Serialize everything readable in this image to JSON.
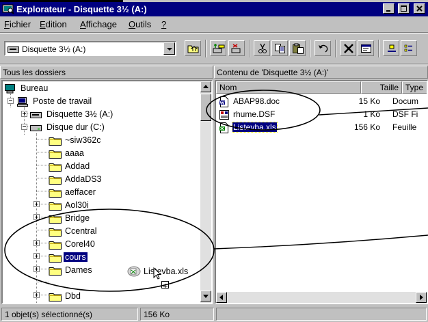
{
  "window": {
    "title": "Explorateur - Disquette 3½ (A:)",
    "title_icon": "explorer-icon",
    "controls": [
      "minimize-icon",
      "maximize-icon",
      "close-icon"
    ]
  },
  "menu": [
    {
      "label": "Fichier",
      "mnemonic": "F",
      "rest": "ichier"
    },
    {
      "label": "Edition",
      "mnemonic": "E",
      "rest": "dition"
    },
    {
      "label": "Affichage",
      "mnemonic": "A",
      "rest": "ffichage"
    },
    {
      "label": "Outils",
      "mnemonic": "O",
      "rest": "utils"
    },
    {
      "label": "?",
      "mnemonic": "?",
      "rest": ""
    }
  ],
  "toolbar": {
    "address_value": "Disquette 3½ (A:)",
    "buttons": [
      "up-folder-icon",
      "map-drive-icon",
      "disconnect-drive-icon",
      "cut-icon",
      "copy-icon",
      "paste-icon",
      "undo-icon",
      "delete-icon",
      "properties-icon",
      "large-icons-icon",
      "small-icons-icon"
    ]
  },
  "left_pane": {
    "header": "Tous les dossiers",
    "tree": [
      {
        "label": "Bureau",
        "icon": "desktop-icon",
        "level": 0,
        "expander": ""
      },
      {
        "label": "Poste de travail",
        "icon": "computer-icon",
        "level": 1,
        "expander": "minus"
      },
      {
        "label": "Disquette 3½ (A:)",
        "icon": "floppy-drive-icon",
        "level": 2,
        "expander": "plus"
      },
      {
        "label": "Disque dur (C:)",
        "icon": "hard-drive-icon",
        "level": 2,
        "expander": "minus"
      },
      {
        "label": "~siw362c",
        "icon": "folder-icon",
        "level": 3,
        "expander": ""
      },
      {
        "label": "aaaa",
        "icon": "folder-icon",
        "level": 3,
        "expander": ""
      },
      {
        "label": "Addad",
        "icon": "folder-icon",
        "level": 3,
        "expander": ""
      },
      {
        "label": "AddaDS3",
        "icon": "folder-icon",
        "level": 3,
        "expander": ""
      },
      {
        "label": "aeffacer",
        "icon": "folder-icon",
        "level": 3,
        "expander": "plus"
      },
      {
        "label": "Aol30i",
        "icon": "folder-icon",
        "level": 3,
        "expander": "plus"
      },
      {
        "label": "Bridge",
        "icon": "folder-icon",
        "level": 3,
        "expander": ""
      },
      {
        "label": "Ccentral",
        "icon": "folder-icon",
        "level": 3,
        "expander": "plus"
      },
      {
        "label": "Corel40",
        "icon": "folder-icon",
        "level": 3,
        "expander": "plus"
      },
      {
        "label": "cours",
        "icon": "folder-icon",
        "level": 3,
        "expander": "plus",
        "selected": true
      },
      {
        "label": "Dames",
        "icon": "folder-icon",
        "level": 3,
        "expander": ""
      },
      {
        "label": "Dbd",
        "icon": "folder-icon",
        "level": 3,
        "expander": "plus"
      }
    ],
    "drag_ghost": {
      "label": "Listevba.xls",
      "icon": "excel-file-icon"
    }
  },
  "right_pane": {
    "header": "Contenu de 'Disquette 3½ (A:)'",
    "columns": [
      "Nom",
      "Taille",
      "Type"
    ],
    "files": [
      {
        "name": "ABAP98.doc",
        "size": "15 Ko",
        "type": "Docum",
        "icon": "word-doc-icon"
      },
      {
        "name": "rhume.DSF",
        "size": "1 Ko",
        "type": "DSF Fi",
        "icon": "dsf-file-icon"
      },
      {
        "name": "Listevba.xls",
        "size": "156 Ko",
        "type": "Feuille",
        "icon": "excel-file-icon",
        "selected": true
      }
    ]
  },
  "status": {
    "selection": "1 objet(s) sélectionné(s)",
    "size": "156 Ko"
  }
}
